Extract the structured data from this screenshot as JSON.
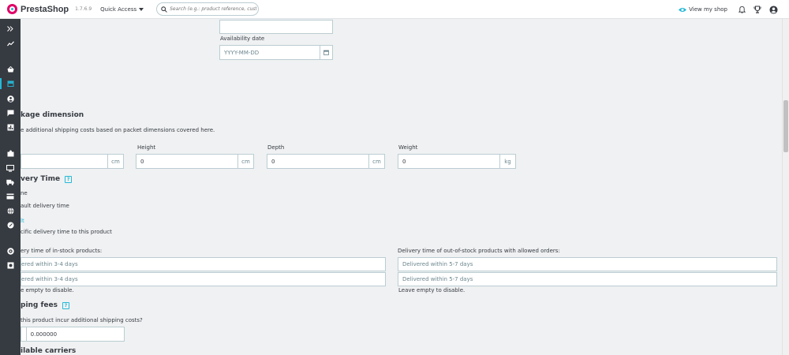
{
  "header": {
    "brand": "PrestaShop",
    "version": "1.7.6.9",
    "quick_access": "Quick Access",
    "search_placeholder": "Search (e.g.: product reference, customer name…)",
    "view_shop": "View my shop"
  },
  "availability": {
    "label": "Availability date",
    "placeholder": "YYYY-MM-DD"
  },
  "package": {
    "title": "kage dimension",
    "help": "e additional shipping costs based on packet dimensions covered here.",
    "fields": [
      {
        "label": "",
        "value": "",
        "unit": "cm"
      },
      {
        "label": "Height",
        "value": "0",
        "unit": "cm"
      },
      {
        "label": "Depth",
        "value": "0",
        "unit": "cm"
      },
      {
        "label": "Weight",
        "value": "0",
        "unit": "kg"
      }
    ]
  },
  "delivery": {
    "title": "very Time",
    "help_icon": "?",
    "option_none_label": "ne",
    "option_default_text": "ault delivery time",
    "option_custom_label": "lt",
    "option_custom_text": "cific delivery time to this product",
    "in_stock": {
      "label": "ery time of in-stock products:",
      "values": [
        "ered within 3-4 days",
        "ered within 3-4 days"
      ],
      "hint": "e empty to disable."
    },
    "out_of_stock": {
      "label": "Delivery time of out-of-stock products with allowed orders:",
      "values": [
        "Delivered within 5-7 days",
        "Delivered within 5-7 days"
      ],
      "hint": "Leave empty to disable."
    }
  },
  "shipping": {
    "title": "ping fees",
    "help_icon": "?",
    "question": "this product incur additional shipping costs?",
    "value": "0.000000"
  },
  "carriers": {
    "title": "ilable carriers"
  },
  "colors": {
    "accent": "#25b9d7",
    "sidebar": "#363a41",
    "background": "#eff1f2"
  }
}
